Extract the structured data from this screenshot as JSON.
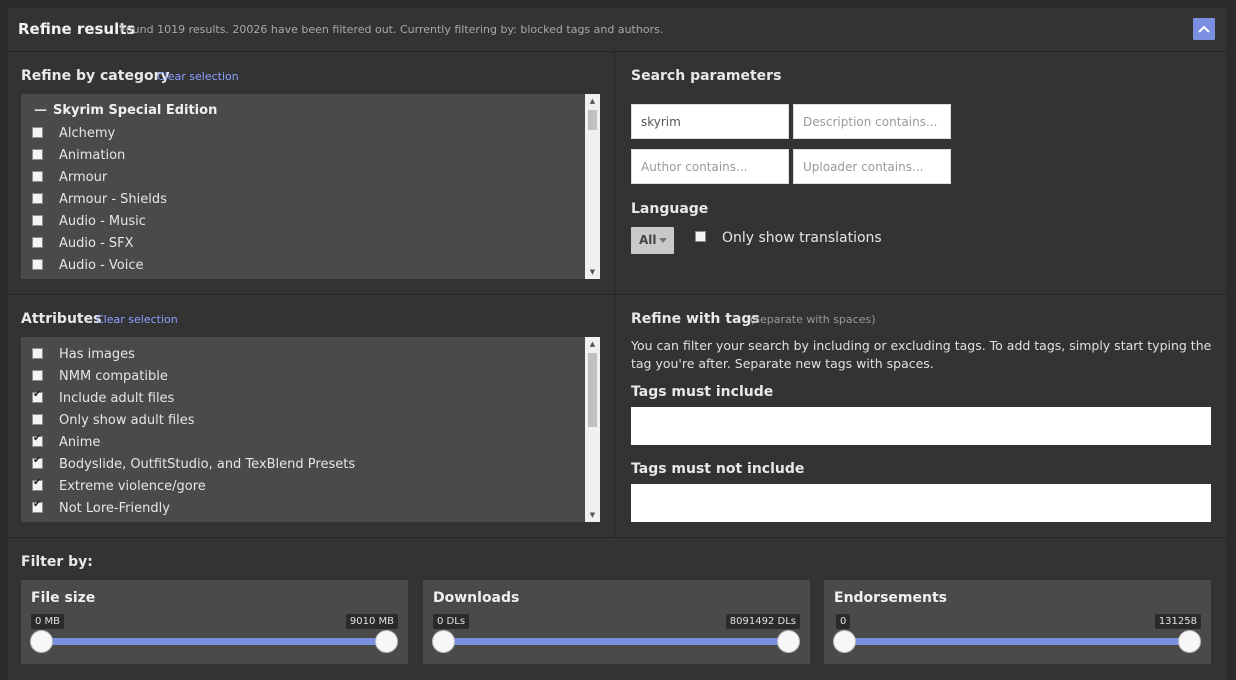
{
  "header": {
    "title": "Refine results",
    "summary": "Found 1019 results. 20026 have been filtered out. Currently filtering by: blocked tags and authors."
  },
  "category": {
    "title": "Refine by category",
    "clear_label": "Clear selection",
    "group_label": "Skyrim Special Edition",
    "items": [
      {
        "label": "Alchemy",
        "checked": false
      },
      {
        "label": "Animation",
        "checked": false
      },
      {
        "label": "Armour",
        "checked": false
      },
      {
        "label": "Armour - Shields",
        "checked": false
      },
      {
        "label": "Audio - Music",
        "checked": false
      },
      {
        "label": "Audio - SFX",
        "checked": false
      },
      {
        "label": "Audio - Voice",
        "checked": false
      }
    ]
  },
  "attributes": {
    "title": "Attributes",
    "clear_label": "Clear selection",
    "items": [
      {
        "label": "Has images",
        "checked": false
      },
      {
        "label": "NMM compatible",
        "checked": false
      },
      {
        "label": "Include adult files",
        "checked": true
      },
      {
        "label": "Only show adult files",
        "checked": false
      },
      {
        "label": "Anime",
        "checked": true
      },
      {
        "label": "Bodyslide, OutfitStudio, and TexBlend Presets",
        "checked": true
      },
      {
        "label": "Extreme violence/gore",
        "checked": true
      },
      {
        "label": "Not Lore-Friendly",
        "checked": true
      }
    ]
  },
  "search": {
    "title": "Search parameters",
    "name_value": "skyrim",
    "description_placeholder": "Description contains...",
    "author_placeholder": "Author contains...",
    "uploader_placeholder": "Uploader contains..."
  },
  "language": {
    "title": "Language",
    "selected": "All",
    "translations_label": "Only show translations"
  },
  "tags": {
    "title": "Refine with tags",
    "hint": "(separate with spaces)",
    "description": "You can filter your search by including or excluding tags. To add tags, simply start typing the tag you're after. Separate new tags with spaces.",
    "include_label": "Tags must include",
    "exclude_label": "Tags must not include"
  },
  "filter": {
    "title": "Filter by:",
    "file_size": {
      "title": "File size",
      "min": "0 MB",
      "max": "9010 MB"
    },
    "downloads": {
      "title": "Downloads",
      "min": "0 DLs",
      "max": "8091492 DLs"
    },
    "endorsements": {
      "title": "Endorsements",
      "min": "0",
      "max": "131258"
    }
  },
  "colors": {
    "accent": "#7b8fe0",
    "link": "#8aa0ff"
  }
}
